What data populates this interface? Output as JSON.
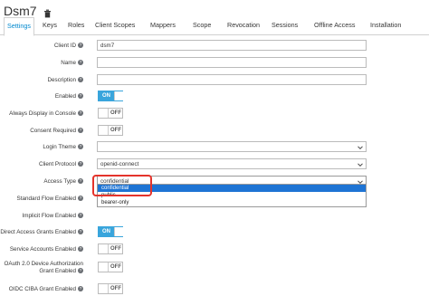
{
  "header": {
    "title": "Dsm7",
    "trash_icon": "trash-icon"
  },
  "tabs": [
    {
      "label": "Settings",
      "active": true
    },
    {
      "label": "Keys"
    },
    {
      "label": "Roles"
    },
    {
      "label": "Client Scopes"
    },
    {
      "label": "Mappers"
    },
    {
      "label": "Scope"
    },
    {
      "label": "Revocation"
    },
    {
      "label": "Sessions"
    },
    {
      "label": "Offline Access"
    },
    {
      "label": "Installation"
    }
  ],
  "fields": {
    "client_id": {
      "label": "Client ID",
      "value": "dsm7"
    },
    "name": {
      "label": "Name",
      "value": ""
    },
    "description": {
      "label": "Description",
      "value": ""
    },
    "enabled": {
      "label": "Enabled",
      "state": "ON"
    },
    "always_display": {
      "label": "Always Display in Console",
      "state": "OFF"
    },
    "consent_required": {
      "label": "Consent Required",
      "state": "OFF"
    },
    "login_theme": {
      "label": "Login Theme",
      "value": ""
    },
    "client_protocol": {
      "label": "Client Protocol",
      "value": "openid-connect"
    },
    "access_type": {
      "label": "Access Type",
      "value": "confidential",
      "options": [
        "confidential",
        "public",
        "bearer-only"
      ]
    },
    "standard_flow": {
      "label": "Standard Flow Enabled"
    },
    "implicit_flow": {
      "label": "Implicit Flow Enabled"
    },
    "direct_access": {
      "label": "Direct Access Grants Enabled",
      "state": "ON"
    },
    "service_accounts": {
      "label": "Service Accounts Enabled",
      "state": "OFF"
    },
    "oauth_device": {
      "label_line1": "OAuth 2.0 Device Authorization",
      "label_line2": "Grant Enabled",
      "state": "OFF"
    },
    "oidc_ciba": {
      "label": "OIDC CIBA Grant Enabled",
      "state": "OFF"
    }
  },
  "help_glyph": "?",
  "colors": {
    "accent": "#0088ce",
    "toggle_on": "#39a5dc",
    "highlight": "#e4332b",
    "selected_option": "#1e74d4"
  }
}
